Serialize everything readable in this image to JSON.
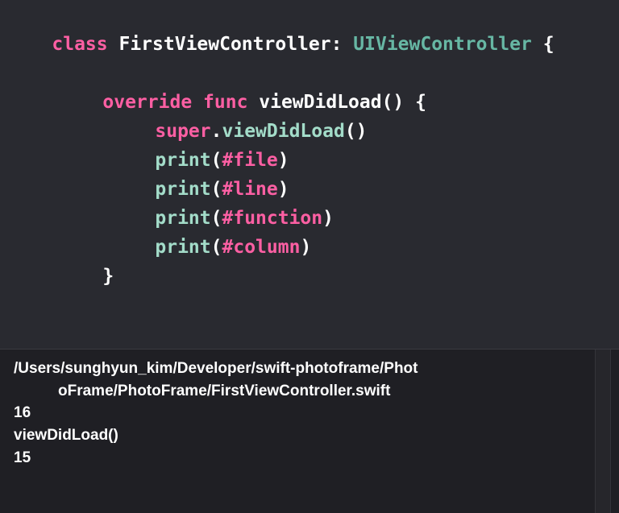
{
  "editor": {
    "line1": {
      "kw": "class",
      "name": " FirstViewController: ",
      "type": "UIViewController",
      "brace": " {"
    },
    "line2": {
      "kw1": "override",
      "kw2": "func",
      "rest": " viewDidLoad() {"
    },
    "line3": {
      "kw": "super",
      "dot": ".",
      "fn": "viewDidLoad",
      "rest": "()"
    },
    "print_calls": [
      {
        "fn": "print",
        "open": "(",
        "arg": "#file",
        "close": ")"
      },
      {
        "fn": "print",
        "open": "(",
        "arg": "#line",
        "close": ")"
      },
      {
        "fn": "print",
        "open": "(",
        "arg": "#function",
        "close": ")"
      },
      {
        "fn": "print",
        "open": "(",
        "arg": "#column",
        "close": ")"
      }
    ],
    "method_close": "}",
    "class_close": "}"
  },
  "console": {
    "output_lines": [
      "/Users/sunghyun_kim/Developer/swift-photoframe/Phot",
      "oFrame/PhotoFrame/FirstViewController.swift",
      "16",
      "viewDidLoad()",
      "15"
    ]
  },
  "colors": {
    "keyword": "#fc5fa3",
    "type": "#67b7a4",
    "function": "#a3dcc9",
    "plain": "#ffffff",
    "editor_bg": "#292a30",
    "console_bg": "#1f1f24"
  }
}
